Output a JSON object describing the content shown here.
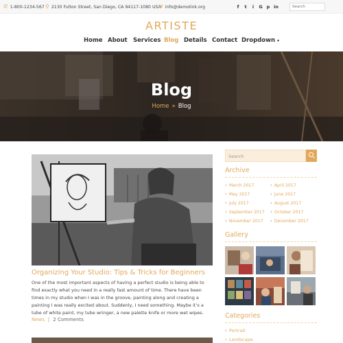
{
  "topbar": {
    "phone": "1-800-1234-567",
    "address": "2130 Fulton Street, San Diego, CA 94117-1080 USA",
    "email": "info@demolink.org",
    "social": [
      "f",
      "t",
      "i",
      "G",
      "p",
      "in"
    ],
    "search_placeholder": "Search"
  },
  "logo": "ARTISTE",
  "nav": {
    "items": [
      "Home",
      "About",
      "Services",
      "Blog",
      "Details",
      "Contact",
      "Dropdown"
    ],
    "active": "Blog"
  },
  "hero": {
    "title": "Blog",
    "breadcrumb_home": "Home",
    "breadcrumb_sep": "»",
    "breadcrumb_current": "Blog"
  },
  "post": {
    "title": "Organizing Your Studio: Tips & Tricks for Beginners",
    "excerpt": "One of the most important aspects of having a perfect studio is being able to find exactly what you need in a really fast amount of time. There have been times in my studio when I was in the groove, painting along and creating a painting I was really excited about. Suddenly, I need something. Maybe it’s a tube of white paint, my tube wringer, a new palette knife or more wet wipes.",
    "category": "News",
    "comments": "2 Comments"
  },
  "sidebar": {
    "search_placeholder": "Search",
    "archive_title": "Archive",
    "archive": [
      "March 2017",
      "April 2017",
      "May 2017",
      "June 2017",
      "July 2017",
      "August 2017",
      "September 2017",
      "October 2017",
      "November 2017",
      "December 2017"
    ],
    "gallery_title": "Gallery",
    "categories_title": "Categories",
    "categories": [
      "Portrait",
      "Landscape"
    ]
  },
  "colors": {
    "accent": "#e0a85a",
    "text": "#333333",
    "muted": "#666666"
  }
}
